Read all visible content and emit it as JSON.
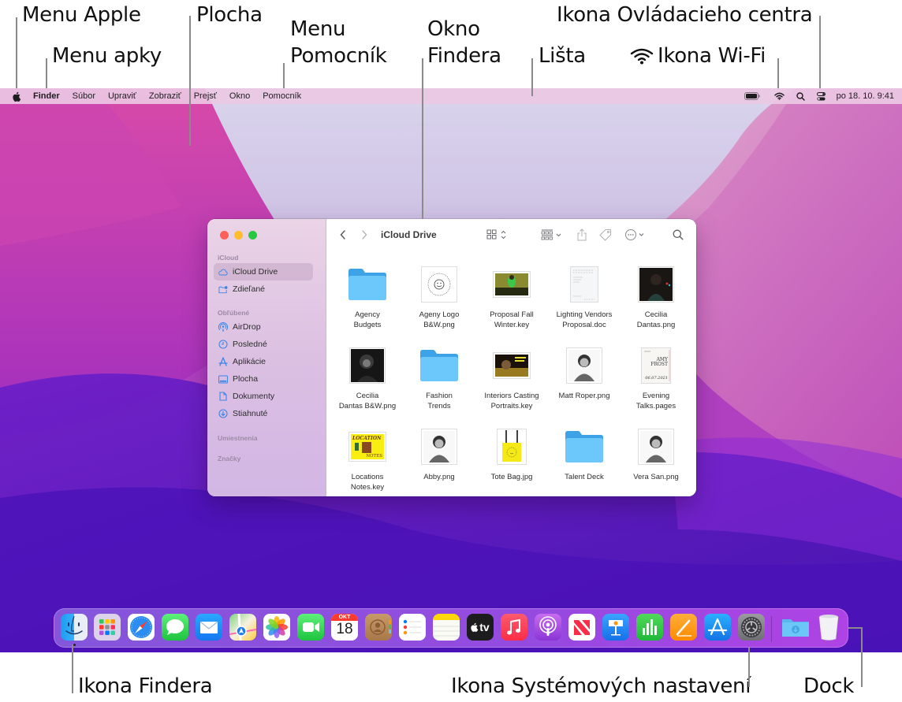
{
  "callouts": {
    "menu_apple": "Menu Apple",
    "menu_app": "Menu apky",
    "desktop": "Plocha",
    "menu_help_line1": "Menu",
    "menu_help_line2": "Pomocník",
    "finder_window_line1": "Okno",
    "finder_window_line2": "Findera",
    "menubar": "Lišta",
    "wifi_icon": "Ikona Wi-Fi",
    "control_center_icon": "Ikona Ovládacieho centra",
    "finder_icon": "Ikona Findera",
    "system_settings_icon": "Ikona Systémových nastavení",
    "dock": "Dock"
  },
  "menubar": {
    "apple_icon": "apple-logo",
    "items": [
      "Finder",
      "Súbor",
      "Upraviť",
      "Zobraziť",
      "Prejsť",
      "Okno",
      "Pomocník"
    ],
    "status": {
      "battery_icon": "battery-icon",
      "wifi_icon": "wifi-icon",
      "search_icon": "spotlight-icon",
      "control_center_icon": "control-center-icon",
      "clock": "po 18. 10. 9:41"
    }
  },
  "finder": {
    "title": "iCloud Drive",
    "sidebar": {
      "sections": [
        {
          "header": "iCloud",
          "items": [
            {
              "label": "iCloud Drive",
              "icon": "cloud-icon",
              "selected": true
            },
            {
              "label": "Zdieľané",
              "icon": "shared-folder-icon",
              "selected": false
            }
          ]
        },
        {
          "header": "Obľúbené",
          "items": [
            {
              "label": "AirDrop",
              "icon": "airdrop-icon"
            },
            {
              "label": "Posledné",
              "icon": "clock-icon"
            },
            {
              "label": "Aplikácie",
              "icon": "applications-icon"
            },
            {
              "label": "Plocha",
              "icon": "desktop-icon"
            },
            {
              "label": "Dokumenty",
              "icon": "document-icon"
            },
            {
              "label": "Stiahnuté",
              "icon": "download-icon"
            }
          ]
        },
        {
          "header": "Umiestnenia",
          "items": []
        },
        {
          "header": "Značky",
          "items": []
        }
      ]
    },
    "toolbar": {
      "back": "chevron-left-icon",
      "forward": "chevron-right-icon",
      "view": "icon-view-icon",
      "group": "group-icon",
      "share": "share-icon",
      "tag": "tag-icon",
      "more": "more-icon",
      "search": "search-icon"
    },
    "files": [
      {
        "line1": "Agency",
        "line2": "Budgets",
        "kind": "folder"
      },
      {
        "line1": "Ageny Logo",
        "line2": "B&W.png",
        "kind": "logo"
      },
      {
        "line1": "Proposal Fall",
        "line2": "Winter.key",
        "kind": "keynote-green"
      },
      {
        "line1": "Lighting Vendors",
        "line2": "Proposal.doc",
        "kind": "doc"
      },
      {
        "line1": "Cecilia",
        "line2": "Dantas.png",
        "kind": "photo-dark"
      },
      {
        "line1": "Cecilia",
        "line2": "Dantas B&W.png",
        "kind": "photo-bw"
      },
      {
        "line1": "Fashion",
        "line2": "Trends",
        "kind": "folder"
      },
      {
        "line1": "Interiors Casting",
        "line2": "Portraits.key",
        "kind": "keynote-yellow"
      },
      {
        "line1": "Matt Roper.png",
        "line2": "",
        "kind": "photo-light"
      },
      {
        "line1": "Evening",
        "line2": "Talks.pages",
        "kind": "pages"
      },
      {
        "line1": "Locations",
        "line2": "Notes.key",
        "kind": "keynote-location"
      },
      {
        "line1": "Abby.png",
        "line2": "",
        "kind": "photo-light"
      },
      {
        "line1": "Tote Bag.jpg",
        "line2": "",
        "kind": "tote"
      },
      {
        "line1": "Talent Deck",
        "line2": "",
        "kind": "folder"
      },
      {
        "line1": "Vera San.png",
        "line2": "",
        "kind": "photo-light"
      }
    ]
  },
  "dock": {
    "calendar_month": "OKT",
    "calendar_day": "18",
    "tv_label": "tv",
    "apps": [
      "Finder",
      "Launchpad",
      "Safari",
      "Správy",
      "Mail",
      "Mapy",
      "Fotky",
      "FaceTime",
      "Kalendár",
      "Kontakty",
      "Pripomienky",
      "Poznámky",
      "TV",
      "Hudba",
      "Podcasty",
      "News",
      "Keynote",
      "Numbers",
      "Pages",
      "App Store",
      "Systémové nastavenia"
    ],
    "extras": [
      "Stiahnuté",
      "Kôš"
    ]
  }
}
